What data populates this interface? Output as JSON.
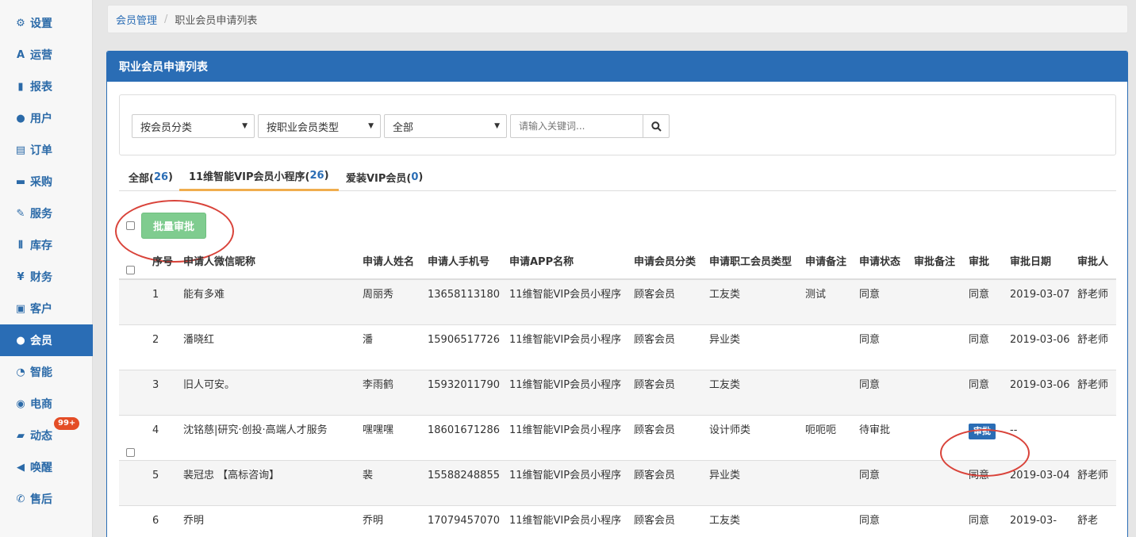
{
  "sidebar": {
    "items": [
      {
        "label": "设置",
        "icon": "⚙",
        "icon_name": "gear-icon"
      },
      {
        "label": "运营",
        "icon": "A",
        "icon_name": "font-icon"
      },
      {
        "label": "报表",
        "icon": "▮",
        "icon_name": "bar-chart-icon"
      },
      {
        "label": "用户",
        "icon": "●",
        "icon_name": "user-icon"
      },
      {
        "label": "订单",
        "icon": "▤",
        "icon_name": "list-icon"
      },
      {
        "label": "采购",
        "icon": "▬",
        "icon_name": "cart-icon"
      },
      {
        "label": "服务",
        "icon": "✎",
        "icon_name": "wrench-icon"
      },
      {
        "label": "库存",
        "icon": "⦀",
        "icon_name": "barcode-icon"
      },
      {
        "label": "财务",
        "icon": "¥",
        "icon_name": "yen-icon"
      },
      {
        "label": "客户",
        "icon": "▣",
        "icon_name": "briefcase-icon"
      },
      {
        "label": "会员",
        "icon": "●",
        "icon_name": "user-icon"
      },
      {
        "label": "智能",
        "icon": "◔",
        "icon_name": "dashboard-icon"
      },
      {
        "label": "电商",
        "icon": "◉",
        "icon_name": "globe-icon"
      },
      {
        "label": "动态",
        "icon": "▰",
        "icon_name": "comment-icon",
        "badge": "99+"
      },
      {
        "label": "唤醒",
        "icon": "◀",
        "icon_name": "bullhorn-icon"
      },
      {
        "label": "售后",
        "icon": "✆",
        "icon_name": "phone-icon"
      }
    ],
    "active_index": 10
  },
  "breadcrumb": {
    "parent": "会员管理",
    "sep": "/",
    "current": "职业会员申请列表"
  },
  "panel": {
    "title": "职业会员申请列表"
  },
  "filters": {
    "member_category": "按会员分类",
    "career_type": "按职业会员类型",
    "status": "全部",
    "keyword_placeholder": "请输入关键词..."
  },
  "tabs": [
    {
      "label": "全部(",
      "count": "26",
      "close": ")"
    },
    {
      "label": "11维智能VIP会员小程序(",
      "count": "26",
      "close": ")"
    },
    {
      "label": "爱装VIP会员(",
      "count": "0",
      "close": ")"
    }
  ],
  "batch_button": "批量审批",
  "table": {
    "headers": [
      "序号",
      "申请人微信昵称",
      "申请人姓名",
      "申请人手机号",
      "申请APP名称",
      "申请会员分类",
      "申请职工会员类型",
      "申请备注",
      "申请状态",
      "审批备注",
      "审批",
      "审批日期",
      "审批人"
    ],
    "rows": [
      {
        "seq": "1",
        "nick": "能有多难",
        "name": "周丽秀",
        "phone": "13658113180",
        "app": "11维智能VIP会员小程序",
        "cat": "顾客会员",
        "type": "工友类",
        "remark": "测试",
        "status": "同意",
        "a_remark": "",
        "approve": "同意",
        "date": "2019-03-07",
        "approver": "舒老师"
      },
      {
        "seq": "2",
        "nick": "潘晓红",
        "name": "潘",
        "phone": "15906517726",
        "app": "11维智能VIP会员小程序",
        "cat": "顾客会员",
        "type": "异业类",
        "remark": "",
        "status": "同意",
        "a_remark": "",
        "approve": "同意",
        "date": "2019-03-06",
        "approver": "舒老师"
      },
      {
        "seq": "3",
        "nick": "旧人可安。",
        "name": "李雨鹤",
        "phone": "15932011790",
        "app": "11维智能VIP会员小程序",
        "cat": "顾客会员",
        "type": "工友类",
        "remark": "",
        "status": "同意",
        "a_remark": "",
        "approve": "同意",
        "date": "2019-03-06",
        "approver": "舒老师"
      },
      {
        "seq": "4",
        "nick": "沈铭慈|研究·创投·高端人才服务",
        "name": "嘿嘿嘿",
        "phone": "18601671286",
        "app": "11维智能VIP会员小程序",
        "cat": "顾客会员",
        "type": "设计师类",
        "remark": "呃呃呃",
        "status": "待审批",
        "a_remark": "",
        "approve": "审批",
        "approve_button": true,
        "date": "--",
        "approver": ""
      },
      {
        "seq": "5",
        "nick": "裴冠忠 【高标咨询】",
        "name": "裴",
        "phone": "15588248855",
        "app": "11维智能VIP会员小程序",
        "cat": "顾客会员",
        "type": "异业类",
        "remark": "",
        "status": "同意",
        "a_remark": "",
        "approve": "同意",
        "date": "2019-03-04",
        "approver": "舒老师"
      },
      {
        "seq": "6",
        "nick": "乔明",
        "name": "乔明",
        "phone": "17079457070",
        "app": "11维智能VIP会员小程序",
        "cat": "顾客会员",
        "type": "工友类",
        "remark": "",
        "status": "同意",
        "a_remark": "",
        "approve": "同意",
        "date": "2019-03-",
        "approver": "舒老"
      }
    ]
  },
  "colors": {
    "primary": "#2a6db5",
    "success_light": "#7fcc8f",
    "tab_active": "#f0ad4e",
    "annotation": "#d9433a",
    "badge": "#e44d26"
  }
}
